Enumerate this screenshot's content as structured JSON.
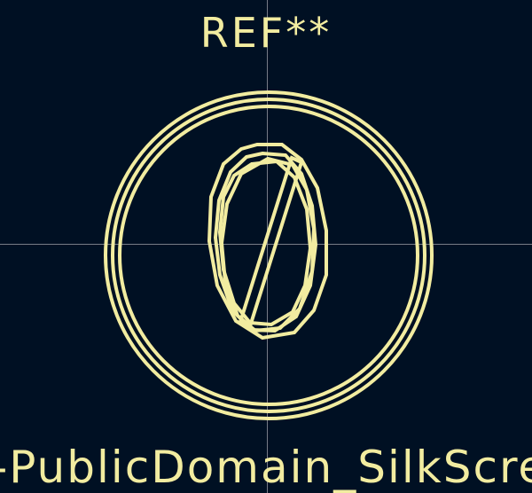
{
  "footprint": {
    "reference": "REF**",
    "value": "CC-PublicDomain_SilkScreen"
  },
  "colors": {
    "background": "#001023",
    "silkscreen": "#f2eca0",
    "crosshair": "#8c8f99"
  },
  "icons": {
    "logo": "cc-public-domain-zero-icon"
  }
}
